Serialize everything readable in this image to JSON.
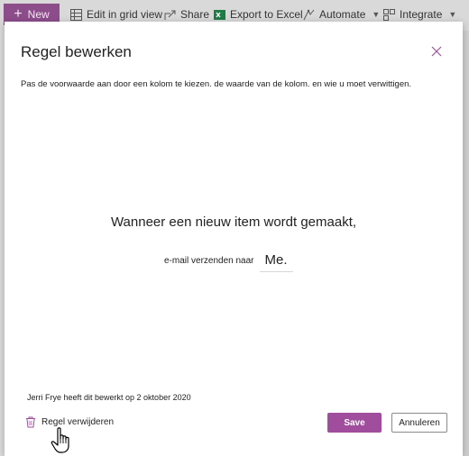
{
  "commandbar": {
    "new_label": "New",
    "edit_grid_label": "Edit in grid view",
    "share_label": "Share",
    "export_label": "Export to Excel",
    "automate_label": "Automate",
    "integrate_label": "Integrate"
  },
  "dialog": {
    "title": "Regel bewerken",
    "description": "Pas de voorwaarde aan door een kolom te kiezen. de waarde van de kolom. en wie u moet verwittigen.",
    "condition_text": "Wanneer een nieuw item wordt gemaakt,",
    "send_label": "e-mail verzenden naar",
    "recipient": "Me.",
    "modified_text": "Jerri Frye heeft dit bewerkt op 2 oktober 2020",
    "delete_label": "Regel verwijderen",
    "save_label": "Save",
    "cancel_label": "Annuleren"
  },
  "colors": {
    "accent": "#a04d9e",
    "new_button": "#8d4d8b",
    "excel_green": "#1d7d44"
  },
  "icons": [
    "plus-icon",
    "grid-icon",
    "share-icon",
    "excel-icon",
    "automate-icon",
    "integrate-icon",
    "close-icon",
    "trash-icon",
    "hand-cursor-icon"
  ]
}
